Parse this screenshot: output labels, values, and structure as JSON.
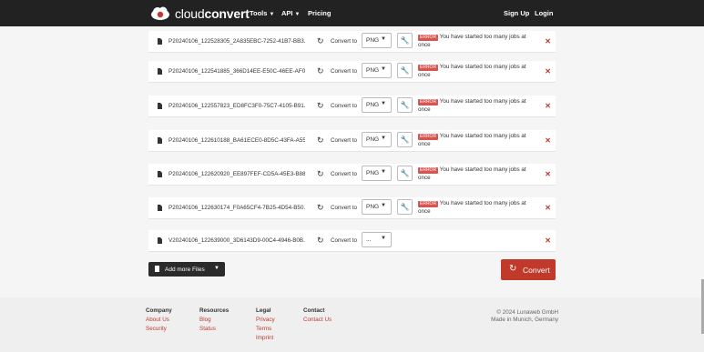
{
  "nav": {
    "brand_light": "cloud",
    "brand_bold": "convert",
    "tools": "Tools",
    "api": "API",
    "pricing": "Pricing",
    "signup": "Sign Up",
    "login": "Login"
  },
  "common": {
    "convert_to": "Convert to",
    "error_badge": "ERROR",
    "error_msg": "You have started too many jobs at once",
    "remove_icon": "close-icon"
  },
  "files": [
    {
      "name": "P20240106_122528305_2A835EBC-7252-41B7-BB3...",
      "format": "PNG",
      "error": true
    },
    {
      "name": "P20240106_122541885_366D14EE-E50C-46EE-AF0...",
      "format": "PNG",
      "error": true
    },
    {
      "name": "P20240106_122557823_ED8FC3F0-75C7-4105-B91...",
      "format": "PNG",
      "error": true
    },
    {
      "name": "P20240106_122610188_BA61ECE0-8D5C-43FA-A55...",
      "format": "PNG",
      "error": true
    },
    {
      "name": "P20240106_122620920_EE897FEF-CD5A-45E3-B88...",
      "format": "PNG",
      "error": true
    },
    {
      "name": "P20240106_122630174_F0A65CF4-7B25-4D54-B50...",
      "format": "PNG",
      "error": true
    },
    {
      "name": "V20240106_122639000_3D6143D9-00C4-4946-B0B...",
      "format": "...",
      "error": false
    }
  ],
  "actions": {
    "add_more": "Add more Files",
    "convert": "Convert"
  },
  "footer": {
    "company_h": "Company",
    "company_l1": "About Us",
    "company_l2": "Security",
    "resources_h": "Resources",
    "resources_l1": "Blog",
    "resources_l2": "Status",
    "legal_h": "Legal",
    "legal_l1": "Privacy",
    "legal_l2": "Terms",
    "legal_l3": "Imprint",
    "contact_h": "Contact",
    "contact_l1": "Contact Us",
    "copyright": "© 2024 Lunaweb GmbH",
    "location": "Made in Munich, Germany"
  },
  "colors": {
    "accent": "#c0392b",
    "navbar": "#222222"
  }
}
